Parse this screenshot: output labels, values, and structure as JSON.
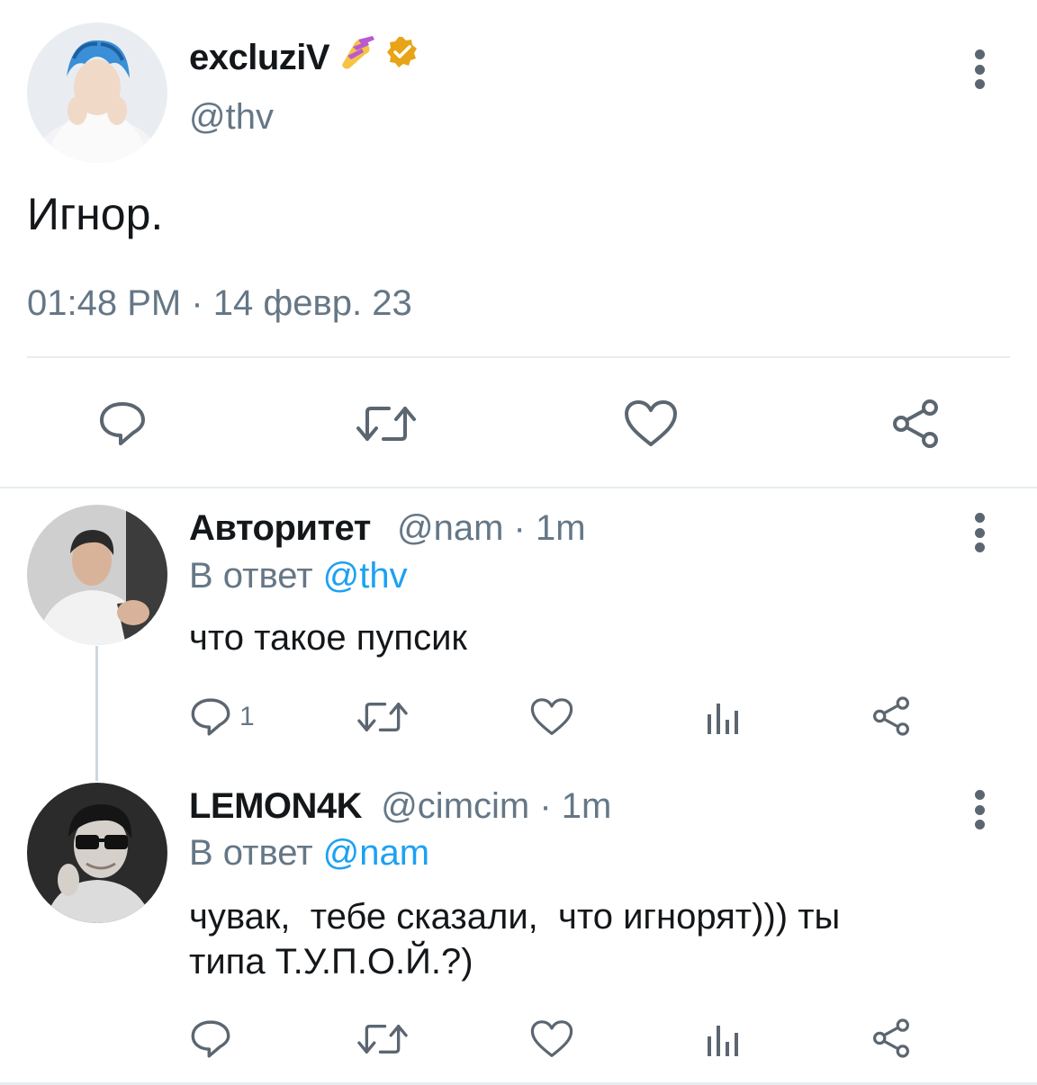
{
  "main_tweet": {
    "display_name": "excluziV",
    "name_emoji": "💅",
    "verified_icon": "verified-badge-icon",
    "handle": "@thv",
    "text": "Игнор.",
    "timestamp": "01:48 PM · 14 февр. 23",
    "actions": [
      "reply-icon",
      "retweet-icon",
      "like-icon",
      "share-icon"
    ]
  },
  "replies": [
    {
      "display_name": "Авторитет",
      "handle": "@nam",
      "time": "1m",
      "separator": " · ",
      "reply_prefix": "В ответ ",
      "reply_to": "@thv",
      "text": "что такое пупсик",
      "reply_count": "1",
      "actions": [
        "reply-icon",
        "retweet-icon",
        "like-icon",
        "analytics-icon",
        "share-icon"
      ]
    },
    {
      "display_name": "LEMON4K",
      "handle": "@cimcim",
      "time": "1m",
      "separator": " · ",
      "reply_prefix": "В ответ ",
      "reply_to": "@nam",
      "text_line1": "чувак,  тебе сказали,  что игнорят))) ты",
      "text_line2": "типа Т.У.П.О.Й.?)",
      "reply_count": "",
      "actions": [
        "reply-icon",
        "retweet-icon",
        "like-icon",
        "analytics-icon",
        "share-icon"
      ]
    }
  ],
  "colors": {
    "text": "#14171a",
    "muted": "#657786",
    "link": "#1da1f2",
    "icon": "#5b6670",
    "divider": "#e6ecf0",
    "verified": "#e8a317"
  }
}
